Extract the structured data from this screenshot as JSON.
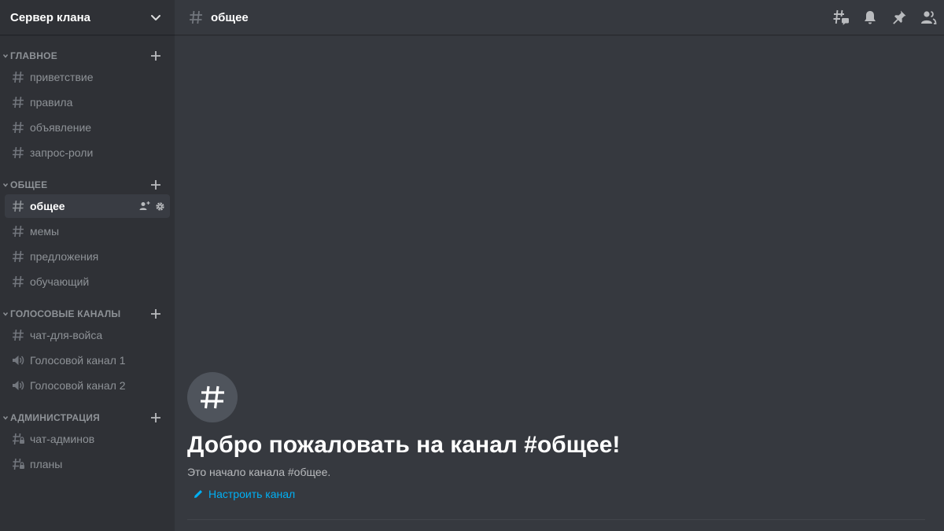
{
  "server": {
    "name": "Сервер клана"
  },
  "categories": [
    {
      "name": "ГЛАВНОЕ",
      "channels": [
        {
          "name": "приветствие",
          "icon": "hash-icon"
        },
        {
          "name": "правила",
          "icon": "hash-icon"
        },
        {
          "name": "объявление",
          "icon": "hash-icon"
        },
        {
          "name": "запрос-роли",
          "icon": "hash-icon"
        }
      ]
    },
    {
      "name": "ОБЩЕЕ",
      "channels": [
        {
          "name": "общее",
          "icon": "hash-icon",
          "selected": true
        },
        {
          "name": "мемы",
          "icon": "hash-icon"
        },
        {
          "name": "предложения",
          "icon": "hash-icon"
        },
        {
          "name": "обучающий",
          "icon": "hash-icon"
        }
      ]
    },
    {
      "name": "ГОЛОСОВЫЕ КАНАЛЫ",
      "channels": [
        {
          "name": "чат-для-войса",
          "icon": "hash-icon"
        },
        {
          "name": "Голосовой канал 1",
          "icon": "speaker-icon"
        },
        {
          "name": "Голосовой канал 2",
          "icon": "speaker-icon"
        }
      ]
    },
    {
      "name": "АДМИНИСТРАЦИЯ",
      "channels": [
        {
          "name": "чат-админов",
          "icon": "locked-hash-icon"
        },
        {
          "name": "планы",
          "icon": "locked-hash-icon"
        }
      ]
    }
  ],
  "header": {
    "channel": "общее"
  },
  "welcome": {
    "title": "Добро пожаловать на канал #общее!",
    "subtitle": "Это начало канала #общее.",
    "edit_label": "Настроить канал"
  },
  "colors": {
    "sidebar_bg": "#2f3136",
    "main_bg": "#36393f",
    "selected_bg": "#393c43",
    "muted_text": "#8e9297",
    "link": "#00b0f4"
  }
}
